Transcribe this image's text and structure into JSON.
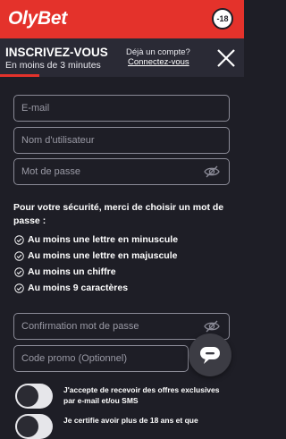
{
  "brand": {
    "logo_text": "OlyBet",
    "age_badge": "-18"
  },
  "header": {
    "title": "INSCRIVEZ-VOUS",
    "subtitle": "En moins de 3 minutes",
    "account_question": "Déjà un compte?",
    "login_link": "Connectez-vous"
  },
  "progress": {
    "fraction": 0.16
  },
  "form": {
    "email_placeholder": "E-mail",
    "username_placeholder": "Nom d'utilisateur",
    "password_placeholder": "Mot de passe",
    "password_rules_title": "Pour votre sécurité, merci de choisir un mot de passe :",
    "rules": [
      "Au moins une lettre en minuscule",
      "Au moins une lettre en majuscule",
      "Au moins un chiffre",
      "Au moins 9 caractères"
    ],
    "confirm_placeholder": "Confirmation mot de passe",
    "promo_placeholder": "Code promo (Optionnel)"
  },
  "consents": [
    "J'accepte de recevoir des offres exclusives par e-mail et/ou SMS",
    "Je certifie avoir plus de 18 ans et que"
  ],
  "colors": {
    "accent": "#e4322b",
    "background": "#1e1e26",
    "header": "#2a2a35"
  },
  "icons": {
    "close": "close-icon",
    "eye": "eye-off-icon",
    "check": "check-circle-icon",
    "chat": "chat-bubble-icon"
  }
}
